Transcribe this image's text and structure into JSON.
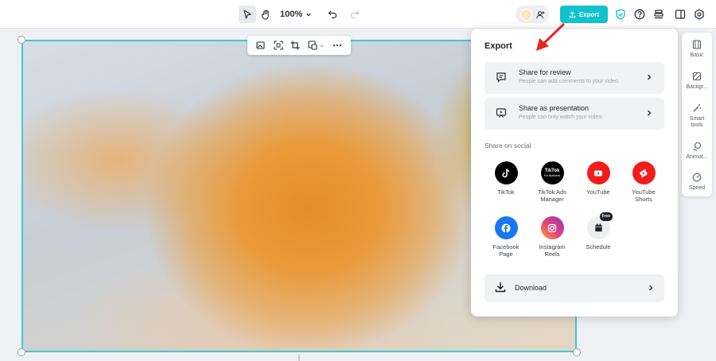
{
  "toolbar": {
    "zoom": "100%",
    "export_label": "Export"
  },
  "rail": {
    "items": [
      {
        "label": "Basic",
        "icon": "film-icon"
      },
      {
        "label": "Backgr...",
        "icon": "background-icon"
      },
      {
        "label": "Smart tools",
        "icon": "magic-wand-icon"
      },
      {
        "label": "Animat...",
        "icon": "animation-icon"
      },
      {
        "label": "Speed",
        "icon": "speed-icon"
      }
    ]
  },
  "panel": {
    "title": "Export",
    "share_review": {
      "title": "Share for review",
      "subtitle": "People can add comments to your video."
    },
    "share_presentation": {
      "title": "Share as presentation",
      "subtitle": "People can only watch your video."
    },
    "social_title": "Share on social",
    "social": [
      {
        "label": "TikTok",
        "icon": "tiktok-icon",
        "color": "#000000"
      },
      {
        "label": "TikTok Ads Manager",
        "icon": "tiktok-business-icon",
        "color": "#000000",
        "logo_text": "TikTok",
        "logo_sub": "For Business"
      },
      {
        "label": "YouTube",
        "icon": "youtube-icon",
        "color": "#f21c1c"
      },
      {
        "label": "YouTube Shorts",
        "icon": "youtube-shorts-icon",
        "color": "#f21c1c"
      },
      {
        "label": "Facebook Page",
        "icon": "facebook-icon",
        "color": "#1877f2"
      },
      {
        "label": "Instagram Reels",
        "icon": "instagram-icon",
        "color": "#d6249f"
      },
      {
        "label": "Schedule",
        "icon": "calendar-icon",
        "color": "#eceef1",
        "badge": "Free"
      }
    ],
    "download_label": "Download"
  },
  "colors": {
    "accent": "#12c2cc",
    "selection": "#3fc9d6",
    "arrow": "#e8261d"
  }
}
